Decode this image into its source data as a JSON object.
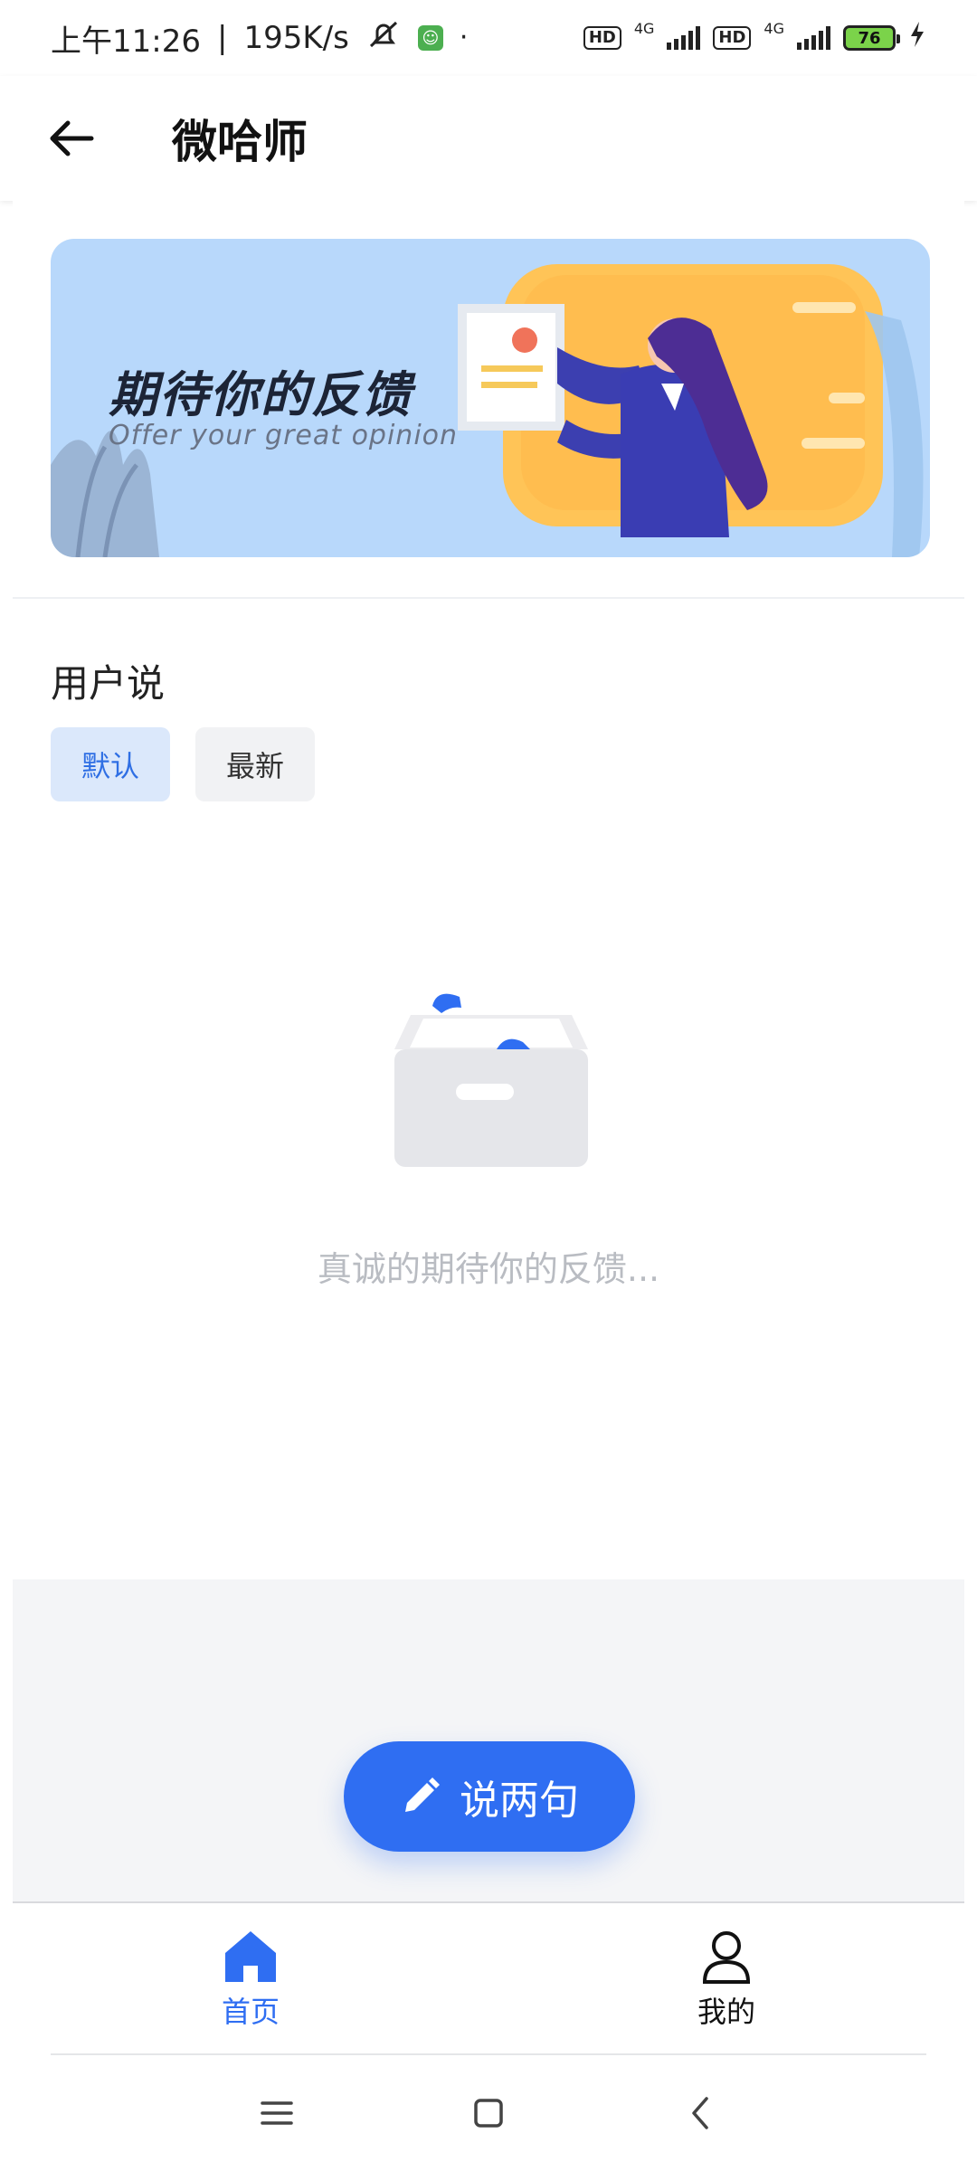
{
  "status_bar": {
    "time": "上午11:26",
    "speed": "195K/s",
    "hd1": "HD",
    "net1": "4G",
    "hd2": "HD",
    "net2": "4G",
    "battery": "76"
  },
  "app_bar": {
    "title": "微哈师"
  },
  "banner": {
    "title": "期待你的反馈",
    "subtitle": "Offer your great opinion"
  },
  "section": {
    "title": "用户说",
    "filters": [
      {
        "label": "默认",
        "active": true
      },
      {
        "label": "最新",
        "active": false
      }
    ]
  },
  "empty_state": {
    "text": "真诚的期待你的反馈..."
  },
  "fab": {
    "label": "说两句",
    "icon": "pencil-icon"
  },
  "tabs": [
    {
      "label": "首页",
      "icon": "home-icon",
      "active": true
    },
    {
      "label": "我的",
      "icon": "user-icon",
      "active": false
    }
  ],
  "colors": {
    "accent": "#2f6ef2",
    "banner_bg": "#b8d8fb",
    "chip_active_bg": "#dbe8fb"
  }
}
